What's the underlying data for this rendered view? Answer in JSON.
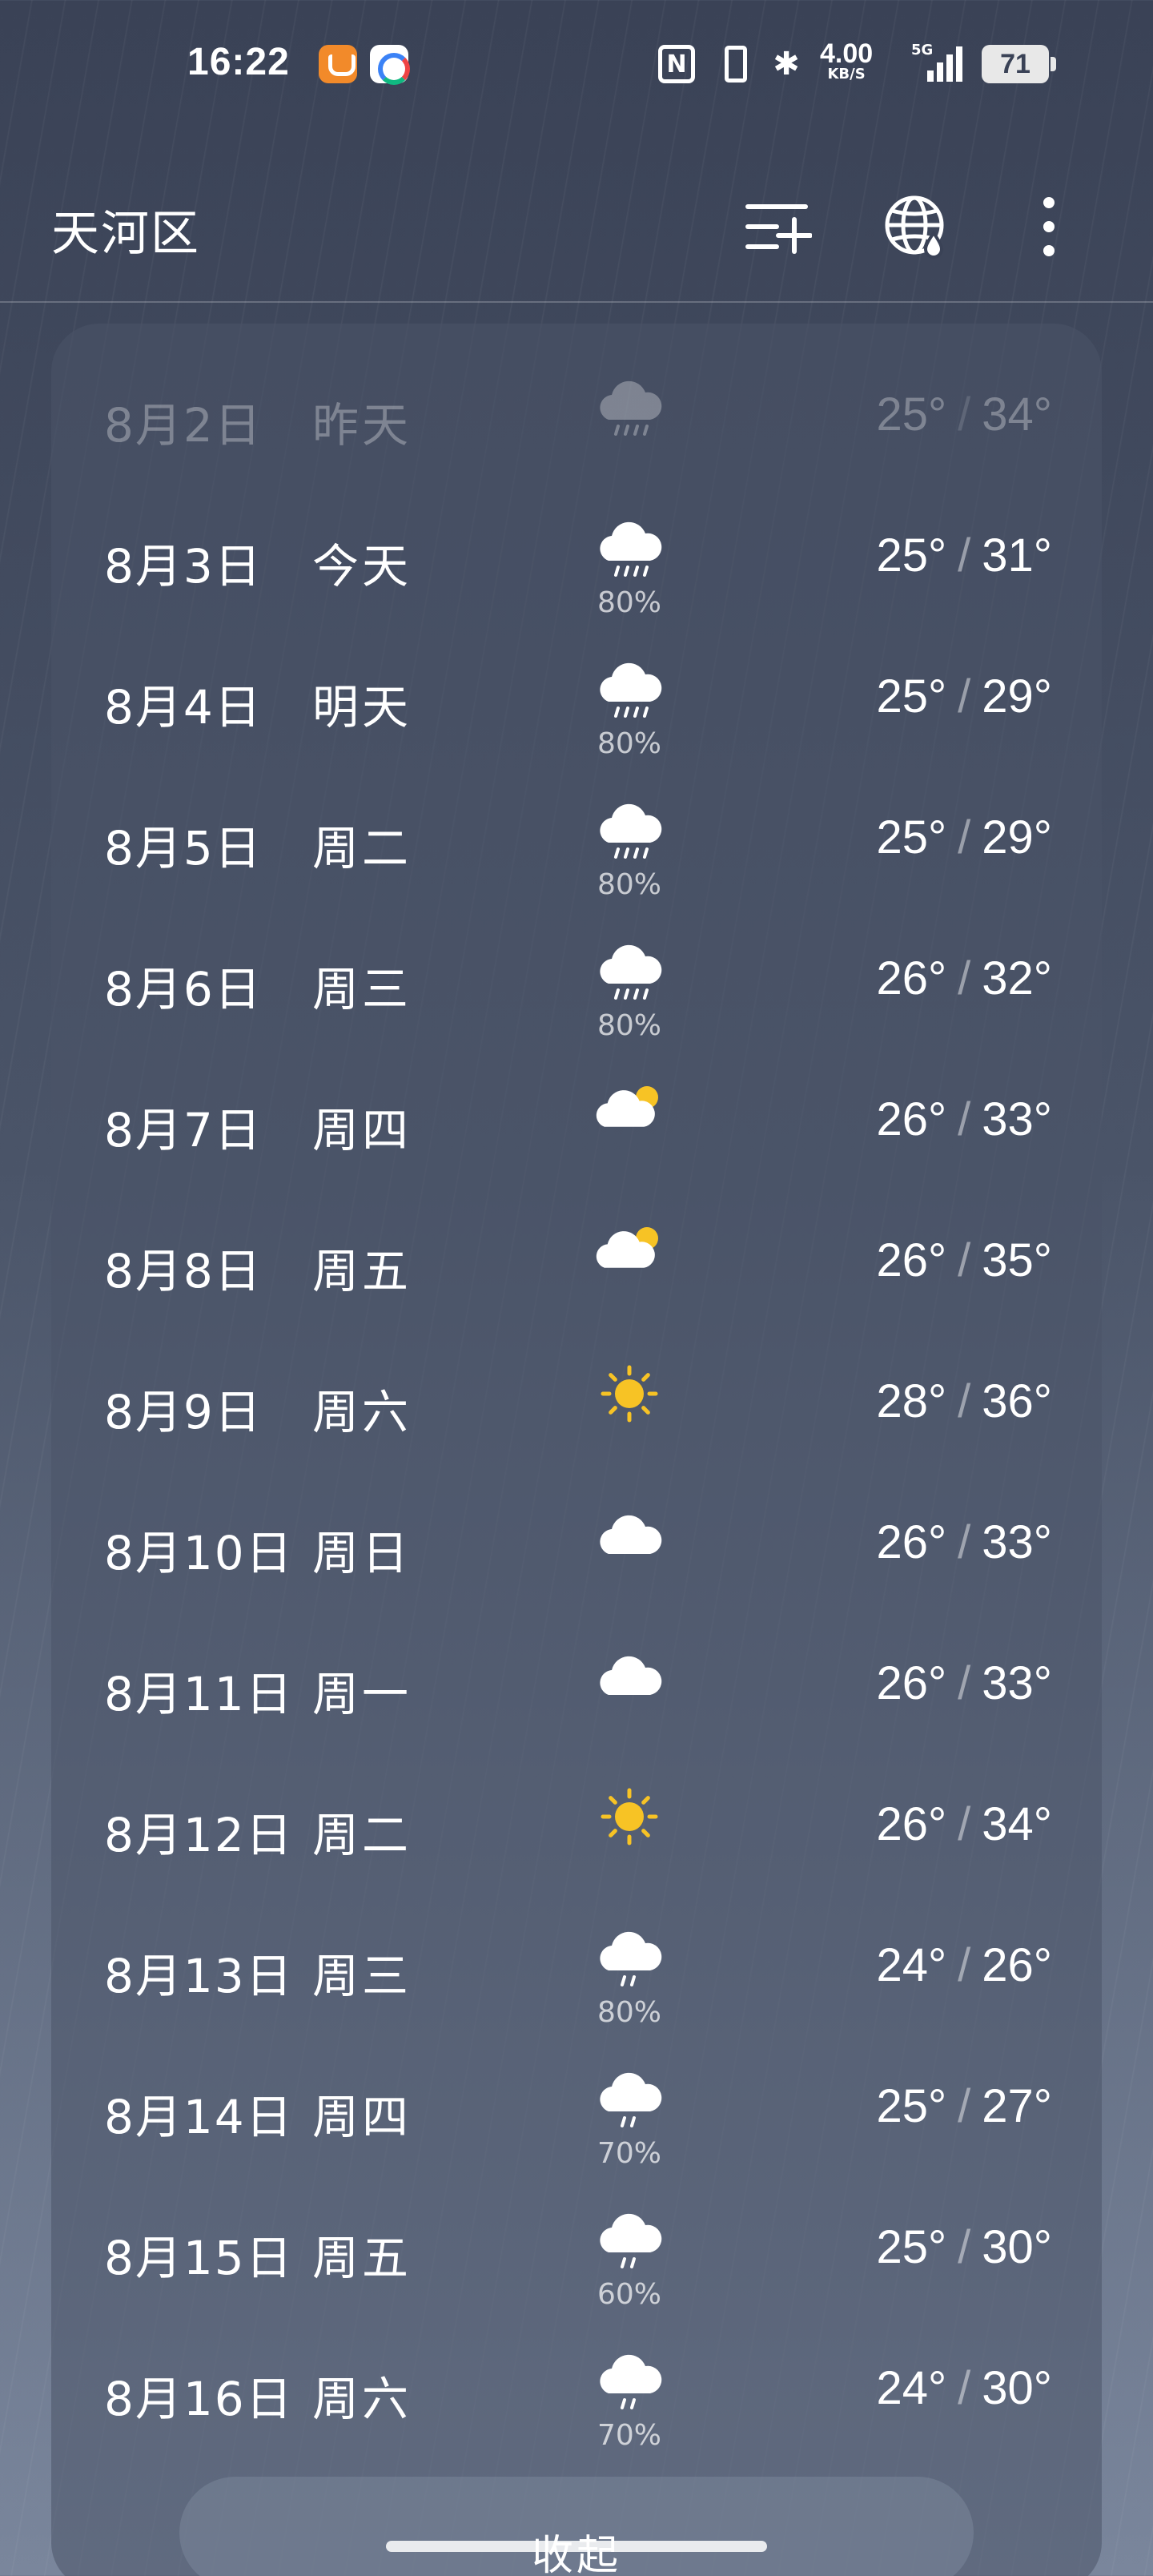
{
  "status_bar": {
    "time": "16:22",
    "nfc_label": "N",
    "bluetooth_glyph": "✱",
    "net_speed_value": "4.00",
    "net_speed_unit": "KB/S",
    "network_type": "5G",
    "battery": "71"
  },
  "header": {
    "location": "天河区",
    "icons": [
      "add-city-icon",
      "globe-weather-icon",
      "more-icon"
    ]
  },
  "forecast": [
    {
      "date": "8月2日",
      "day": "昨天",
      "icon": "rain",
      "precip": "",
      "low": "25°",
      "high": "34°",
      "past": true
    },
    {
      "date": "8月3日",
      "day": "今天",
      "icon": "rain",
      "precip": "80%",
      "low": "25°",
      "high": "31°",
      "past": false
    },
    {
      "date": "8月4日",
      "day": "明天",
      "icon": "rain",
      "precip": "80%",
      "low": "25°",
      "high": "29°",
      "past": false
    },
    {
      "date": "8月5日",
      "day": "周二",
      "icon": "rain",
      "precip": "80%",
      "low": "25°",
      "high": "29°",
      "past": false
    },
    {
      "date": "8月6日",
      "day": "周三",
      "icon": "rain",
      "precip": "80%",
      "low": "26°",
      "high": "32°",
      "past": false
    },
    {
      "date": "8月7日",
      "day": "周四",
      "icon": "partly-cloudy",
      "precip": "",
      "low": "26°",
      "high": "33°",
      "past": false
    },
    {
      "date": "8月8日",
      "day": "周五",
      "icon": "partly-cloudy",
      "precip": "",
      "low": "26°",
      "high": "35°",
      "past": false
    },
    {
      "date": "8月9日",
      "day": "周六",
      "icon": "sunny",
      "precip": "",
      "low": "28°",
      "high": "36°",
      "past": false
    },
    {
      "date": "8月10日",
      "day": "周日",
      "icon": "cloudy",
      "precip": "",
      "low": "26°",
      "high": "33°",
      "past": false
    },
    {
      "date": "8月11日",
      "day": "周一",
      "icon": "cloudy",
      "precip": "",
      "low": "26°",
      "high": "33°",
      "past": false
    },
    {
      "date": "8月12日",
      "day": "周二",
      "icon": "sunny",
      "precip": "",
      "low": "26°",
      "high": "34°",
      "past": false
    },
    {
      "date": "8月13日",
      "day": "周三",
      "icon": "light-rain",
      "precip": "80%",
      "low": "24°",
      "high": "26°",
      "past": false
    },
    {
      "date": "8月14日",
      "day": "周四",
      "icon": "light-rain",
      "precip": "70%",
      "low": "25°",
      "high": "27°",
      "past": false
    },
    {
      "date": "8月15日",
      "day": "周五",
      "icon": "light-rain",
      "precip": "60%",
      "low": "25°",
      "high": "30°",
      "past": false
    },
    {
      "date": "8月16日",
      "day": "周六",
      "icon": "light-rain",
      "precip": "70%",
      "low": "24°",
      "high": "30°",
      "past": false
    }
  ],
  "collapse_label": "收起",
  "colors": {
    "sun": "#f7c325",
    "cloud": "#ffffff",
    "background_top": "#3a4256",
    "background_bottom": "#7a869c"
  }
}
